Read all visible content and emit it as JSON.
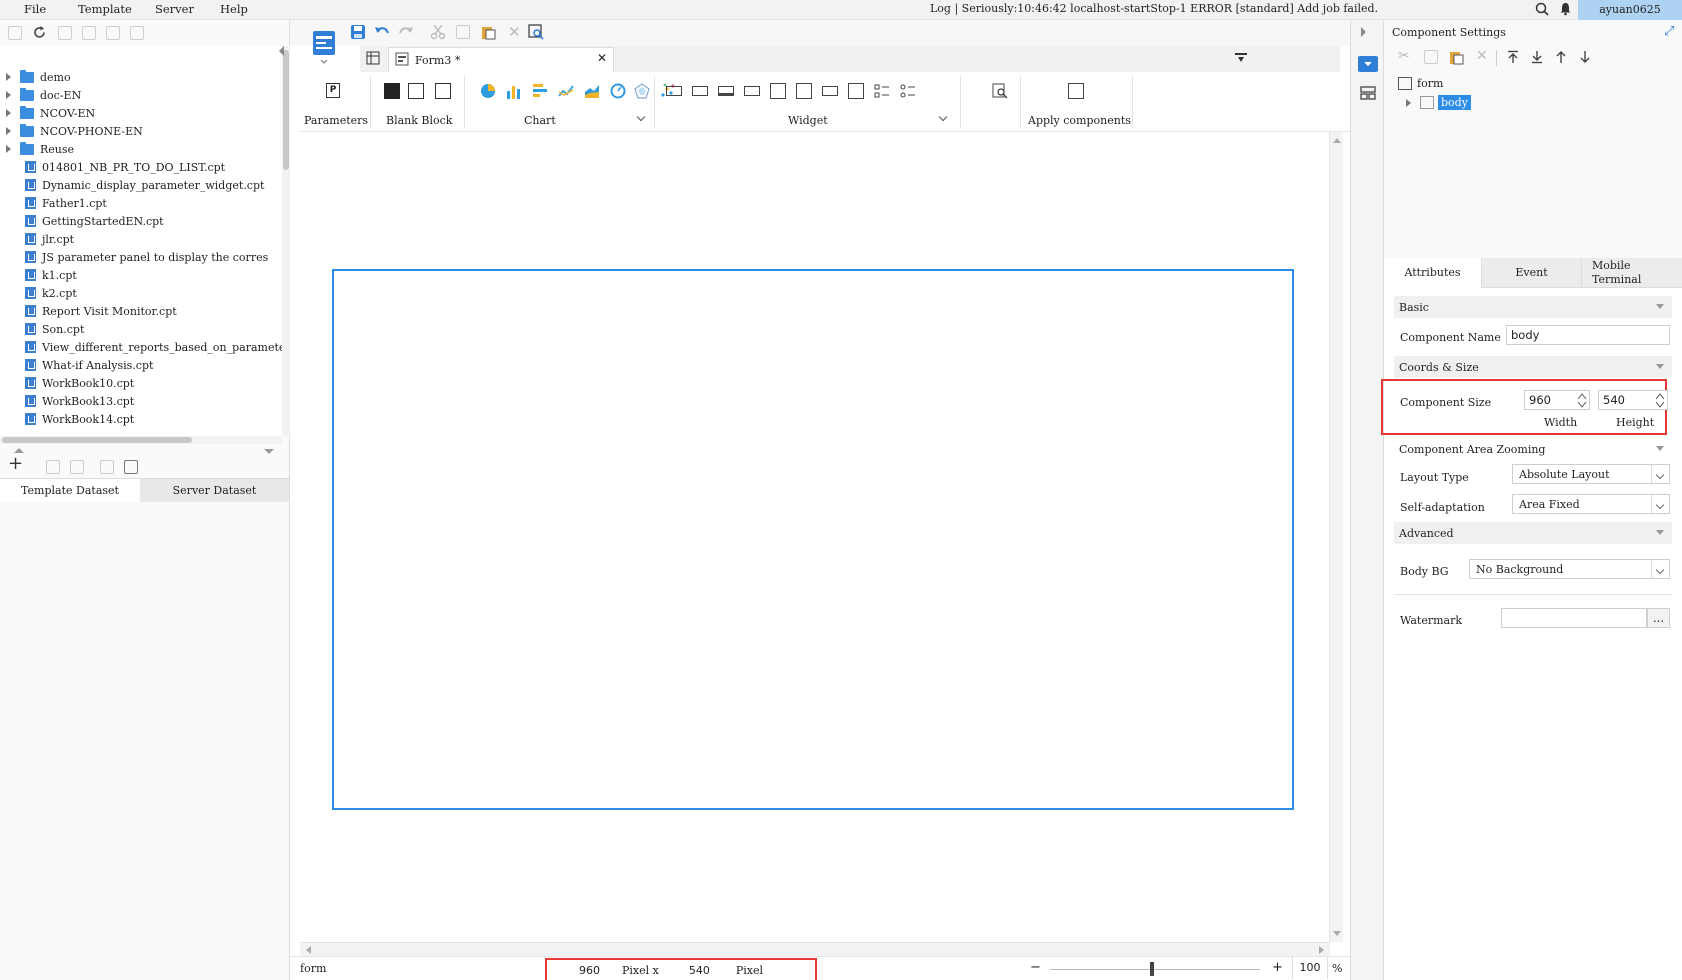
{
  "menubar": {
    "items": [
      "File",
      "Template",
      "Server",
      "Help"
    ],
    "log_text": "Log | Seriously:10:46:42 localhost-startStop-1 ERROR [standard] Add job failed.",
    "user": "ayuan0625"
  },
  "tree": {
    "folders": [
      "demo",
      "doc-EN",
      "NCOV-EN",
      "NCOV-PHONE-EN",
      "Reuse"
    ],
    "files": [
      "014801_NB_PR_TO_DO_LIST.cpt",
      "Dynamic_display_parameter_widget.cpt",
      "Father1.cpt",
      "GettingStartedEN.cpt",
      "jlr.cpt",
      "JS parameter panel to display the corres",
      "k1.cpt",
      "k2.cpt",
      "Report Visit Monitor.cpt",
      "Son.cpt",
      "View_different_reports_based_on_paramete",
      "What-if Analysis.cpt",
      "WorkBook10.cpt",
      "WorkBook13.cpt",
      "WorkBook14.cpt"
    ]
  },
  "dataset_tabs": [
    "Template Dataset",
    "Server Dataset"
  ],
  "editor": {
    "tab_title": "Form3 *"
  },
  "ribbon": {
    "parameters": "Parameters",
    "blank_block": "Blank Block",
    "chart": "Chart",
    "widget": "Widget",
    "apply_components": "Apply components"
  },
  "status": {
    "left": "form",
    "width": "960",
    "unit1": "Pixel x",
    "height": "540",
    "unit2": "Pixel",
    "zoom": "100",
    "pct": "%"
  },
  "settings": {
    "title": "Component Settings",
    "tree_form": "form",
    "tree_body": "body",
    "tabs": [
      "Attributes",
      "Event",
      "Mobile Terminal"
    ],
    "sections": {
      "basic": "Basic",
      "coords": "Coords & Size",
      "zooming": "Component Area Zooming",
      "advanced": "Advanced"
    },
    "component_name_label": "Component Name",
    "component_name": "body",
    "component_size_label": "Component Size",
    "width_value": "960",
    "height_value": "540",
    "width_label": "Width",
    "height_label": "Height",
    "layout_type_label": "Layout Type",
    "layout_type": "Absolute Layout",
    "self_adapt_label": "Self-adaptation",
    "self_adapt": "Area Fixed",
    "body_bg_label": "Body BG",
    "body_bg": "No Background",
    "watermark_label": "Watermark",
    "watermark_btn": "..."
  },
  "colors": {
    "accent": "#2d8ce6",
    "highlight_red": "#e53935",
    "user_bg": "#aed2f2"
  }
}
